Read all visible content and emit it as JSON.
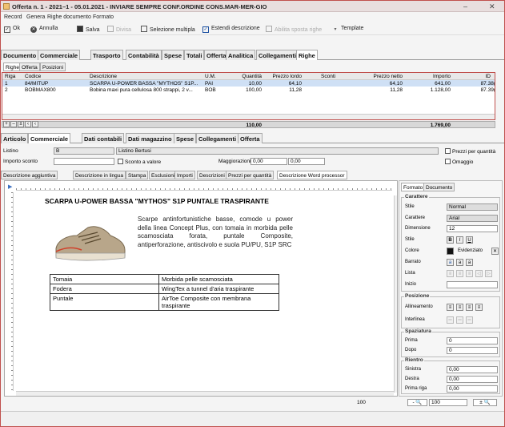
{
  "window": {
    "title": "Offerta n. 1 - 2021–1 - 05.01.2021 - INVIARE SEMPRE CONF.ORDINE CONS.MAR-MER-GIO",
    "minimize": "–",
    "close": "✕"
  },
  "menu": [
    "Record",
    "Genera",
    "Righe documento",
    "Formato"
  ],
  "toolbar": {
    "ok": "Ok",
    "annulla": "Annulla",
    "salva": "Salva",
    "divisa": "Divisa",
    "selezione": "Selezione multipla",
    "estendi": "Estendi descrizione",
    "abilita": "Abilita sposta righe",
    "template": "Template"
  },
  "main_tabs": [
    "Documento",
    "Commerciale",
    "Trasporto",
    "Contabilità",
    "Spese",
    "Totali",
    "Offerta",
    "Analitica",
    "Collegamenti",
    "Righe"
  ],
  "sub_tabs": [
    "Righe",
    "Offerta",
    "Posizioni"
  ],
  "grid": {
    "headers": [
      "Riga",
      "Codice",
      "Descrizione",
      "U.M.",
      "Quantità",
      "Prezzo lordo",
      "Sconti",
      "Prezzo netto",
      "Importo",
      "ID"
    ],
    "rows": [
      {
        "riga": "1",
        "codice": "84/MITUP",
        "descrizione": "SCARPA U-POWER BASSA \"MYTHOS\" S1P...",
        "um": "PAI",
        "quantita": "10,00",
        "prezzo_lordo": "64,10",
        "sconti": "",
        "prezzo_netto": "64,10",
        "importo": "641,00",
        "id": "87.38("
      },
      {
        "riga": "2",
        "codice": "BOBMAX800",
        "descrizione": "Bobina maxi pura cellulosa 800 strappi, 2 v...",
        "um": "BOB",
        "quantita": "100,00",
        "prezzo_lordo": "11,28",
        "sconti": "",
        "prezzo_netto": "11,28",
        "importo": "1.128,00",
        "id": "87.39("
      }
    ],
    "total_qty": "110,00",
    "total_amount": "1.769,00",
    "row_buttons": [
      "+",
      "–",
      "±",
      "‹",
      "‹"
    ]
  },
  "detail_tabs": [
    "Articolo",
    "Commerciale",
    "Dati contabili",
    "Dati magazzino",
    "Spese",
    "Collegamenti",
    "Offerta"
  ],
  "detail": {
    "listino_label": "Listino",
    "listino_value": "B",
    "listino_name": "Listino Bertusi",
    "importo_sconto_label": "Importo sconto",
    "sconto_valore_label": "Sconto a valore",
    "maggiorazioni_label": "Maggiorazioni",
    "magg1": "0,00",
    "magg2": "0,00",
    "prezzi_qta_label": "Prezzi per quantità",
    "omaggio_label": "Omaggio"
  },
  "editor_tabs": [
    "Descrizione aggiuntiva",
    "Descrizione in lingua",
    "Stampa",
    "Esclusioni",
    "Importi",
    "Descrizioni",
    "Prezzi per quantità",
    "Descrizione Word processor"
  ],
  "document": {
    "title": "SCARPA U-POWER BASSA \"MYTHOS\" S1P PUNTALE TRASPIRANTE",
    "description": "Scarpe antinfortunistiche basse, comode u power della linea Concept Plus, con tomaia in morbida pelle scamosciata forata, puntale Composite, antiperforazione, antiscivolo e suola PU/PU, S1P SRC",
    "table": [
      [
        "Tomaia",
        "Morbida pelle scamosciata"
      ],
      [
        "Fodera",
        "WingTex a tunnel d'aria traspirante"
      ],
      [
        "Puntale",
        "AirToe Composite con membrana traspirante"
      ]
    ]
  },
  "format_panel": {
    "tabs": [
      "Formato",
      "Documento"
    ],
    "carattere_title": "Carattere",
    "stile_label": "Stile",
    "stile_value": "Normal",
    "carattere_label": "Carattere",
    "carattere_value": "Arial",
    "dimensione_label": "Dimensione",
    "dimensione_value": "12",
    "stile2_label": "Stile",
    "colore_label": "Colore",
    "evidenziato_label": "Evidenziato",
    "barrato_label": "Barrato",
    "lista_label": "Lista",
    "inizio_label": "Inizio",
    "posizione_title": "Posizione",
    "allineamento_label": "Allineamento",
    "interlinea_label": "Interlinea",
    "spaziatura_title": "Spaziatura",
    "prima_label": "Prima",
    "prima_value": "0",
    "dopo_label": "Dopo",
    "dopo_value": "0",
    "rientro_title": "Rientro",
    "sinistra_label": "Sinistra",
    "sinistra_value": "0,00",
    "destra_label": "Destra",
    "destra_value": "0,00",
    "primariga_label": "Prima riga",
    "primariga_value": "0,00"
  },
  "zoom": {
    "left_value": "100",
    "right_value": "100"
  }
}
